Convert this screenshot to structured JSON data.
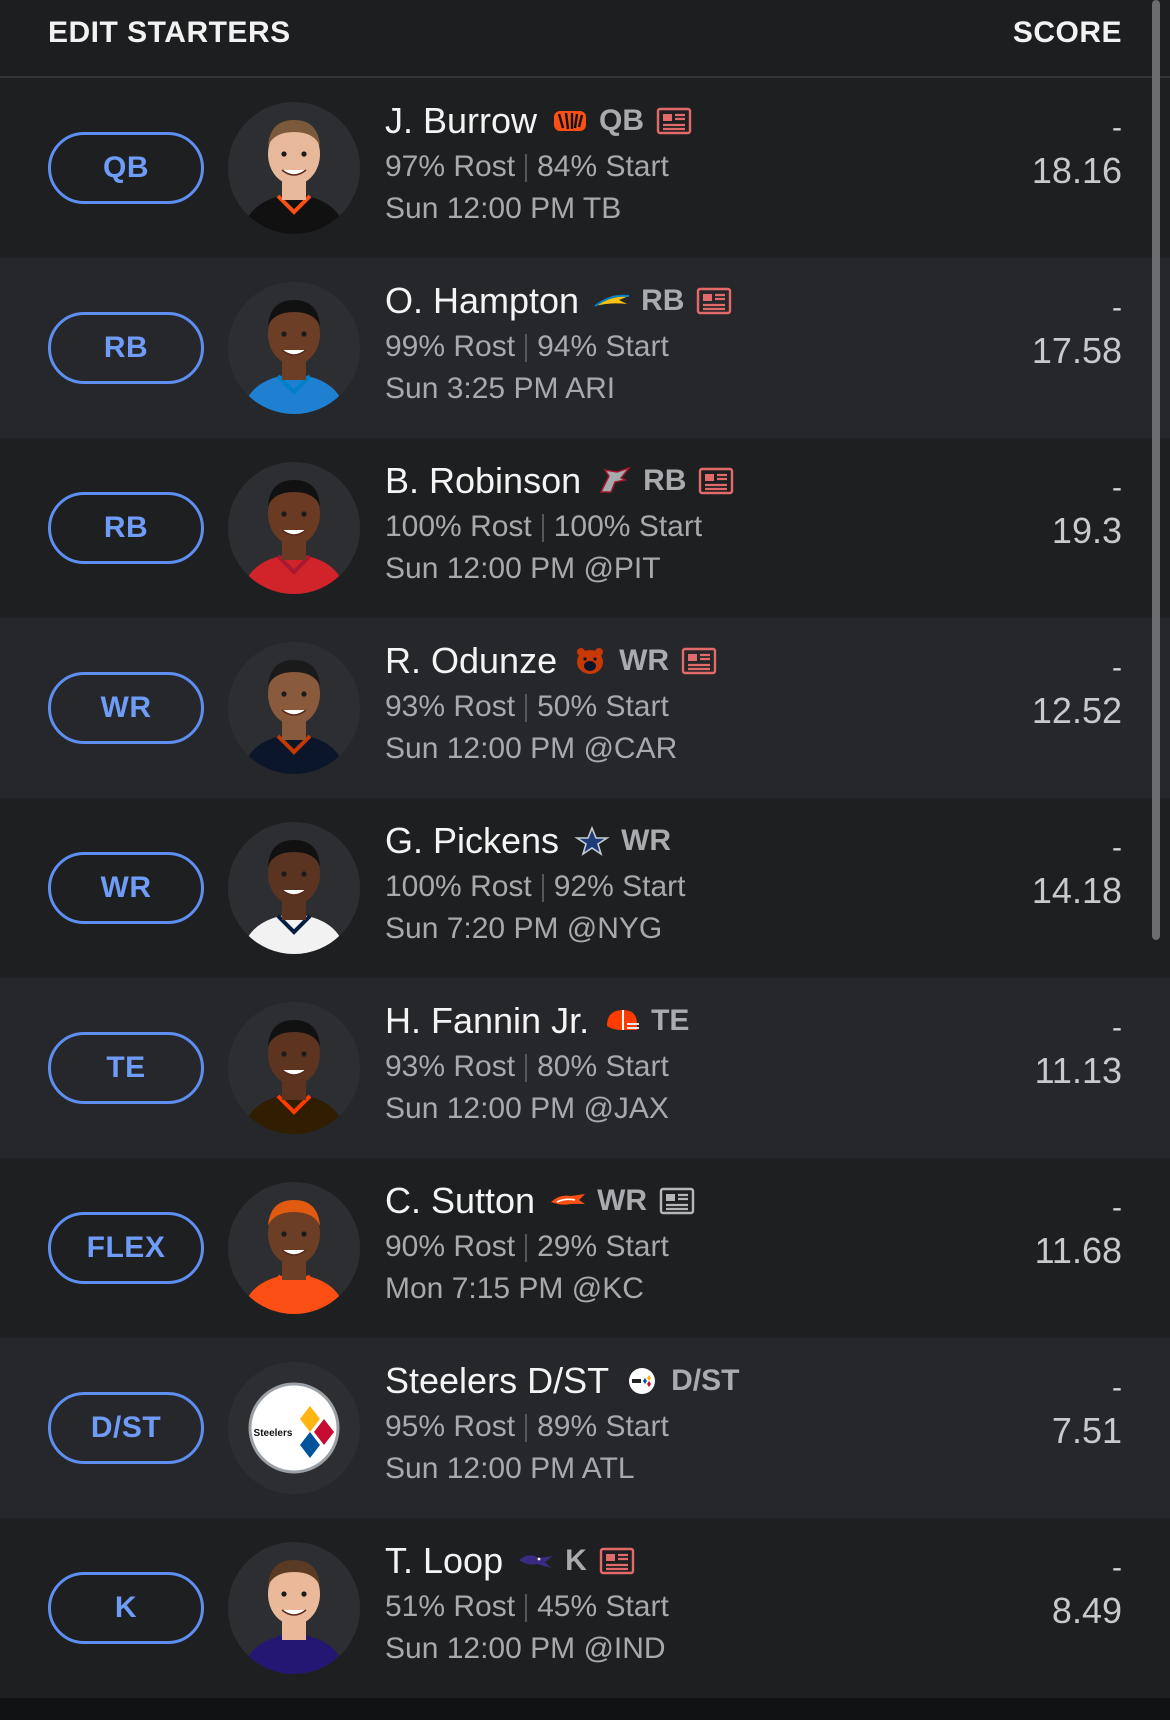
{
  "header": {
    "title": "EDIT STARTERS",
    "score_label": "SCORE"
  },
  "rows": [
    {
      "slot": "QB",
      "name": "J. Burrow",
      "team_icon": "bengals-logo-icon",
      "pos": "QB",
      "news": true,
      "rost": "97% Rost",
      "start": "84% Start",
      "game": "Sun 12:00 PM  TB",
      "score": "-",
      "proj": "18.16",
      "accent": "#fb4f14",
      "jersey": "#111111",
      "skin": "#e8b89a",
      "hair": "#7a5a3a"
    },
    {
      "slot": "RB",
      "name": "O. Hampton",
      "team_icon": "chargers-bolt-icon",
      "pos": "RB",
      "news": true,
      "rost": "99% Rost",
      "start": "94% Start",
      "game": "Sun 3:25 PM  ARI",
      "score": "-",
      "proj": "17.58",
      "accent": "#0080c6",
      "jersey": "#1f7fd1",
      "skin": "#6b3e25",
      "hair": "#111111"
    },
    {
      "slot": "RB",
      "name": "B. Robinson",
      "team_icon": "falcons-logo-icon",
      "pos": "RB",
      "news": true,
      "rost": "100% Rost",
      "start": "100% Start",
      "game": "Sun 12:00 PM  @PIT",
      "score": "-",
      "proj": "19.3",
      "accent": "#a71930",
      "jersey": "#d1232a",
      "skin": "#6a3a22",
      "hair": "#111111"
    },
    {
      "slot": "WR",
      "name": "R. Odunze",
      "team_icon": "bears-logo-icon",
      "pos": "WR",
      "news": true,
      "rost": "93% Rost",
      "start": "50% Start",
      "game": "Sun 12:00 PM  @CAR",
      "score": "-",
      "proj": "12.52",
      "accent": "#c83803",
      "jersey": "#0b162a",
      "skin": "#8a5a3c",
      "hair": "#1a1a1a"
    },
    {
      "slot": "WR",
      "name": "G. Pickens",
      "team_icon": "cowboys-star-icon",
      "pos": "WR",
      "news": false,
      "rost": "100% Rost",
      "start": "92% Start",
      "game": "Sun 7:20 PM  @NYG",
      "score": "-",
      "proj": "14.18",
      "accent": "#041e42",
      "jersey": "#f2f2f2",
      "skin": "#5a3420",
      "hair": "#111111"
    },
    {
      "slot": "TE",
      "name": "H. Fannin Jr.",
      "team_icon": "browns-helmet-icon",
      "pos": "TE",
      "news": false,
      "rost": "93% Rost",
      "start": "80% Start",
      "game": "Sun 12:00 PM  @JAX",
      "score": "-",
      "proj": "11.13",
      "accent": "#ff3c00",
      "jersey": "#311d00",
      "skin": "#5c341f",
      "hair": "#111111"
    },
    {
      "slot": "FLEX",
      "name": "C. Sutton",
      "team_icon": "broncos-logo-icon",
      "pos": "WR",
      "news": true,
      "rost": "90% Rost",
      "start": "29% Start",
      "game": "Mon 7:15 PM  @KC",
      "score": "-",
      "proj": "11.68",
      "accent": "#fb4f14",
      "jersey": "#fb4f14",
      "skin": "#6b3e25",
      "hair": "#e05a10"
    },
    {
      "slot": "D/ST",
      "name": "Steelers D/ST",
      "team_icon": "steelers-logo-icon",
      "pos": "D/ST",
      "news": false,
      "rost": "95% Rost",
      "start": "89% Start",
      "game": "Sun 12:00 PM  ATL",
      "score": "-",
      "proj": "7.51",
      "logo_text": "Steelers"
    },
    {
      "slot": "K",
      "name": "T. Loop",
      "team_icon": "ravens-logo-icon",
      "pos": "K",
      "news": true,
      "rost": "51% Rost",
      "start": "45% Start",
      "game": "Sun 12:00 PM  @IND",
      "score": "-",
      "proj": "8.49",
      "accent": "#241773",
      "jersey": "#241773",
      "skin": "#eab99a",
      "hair": "#5a3a22"
    }
  ]
}
